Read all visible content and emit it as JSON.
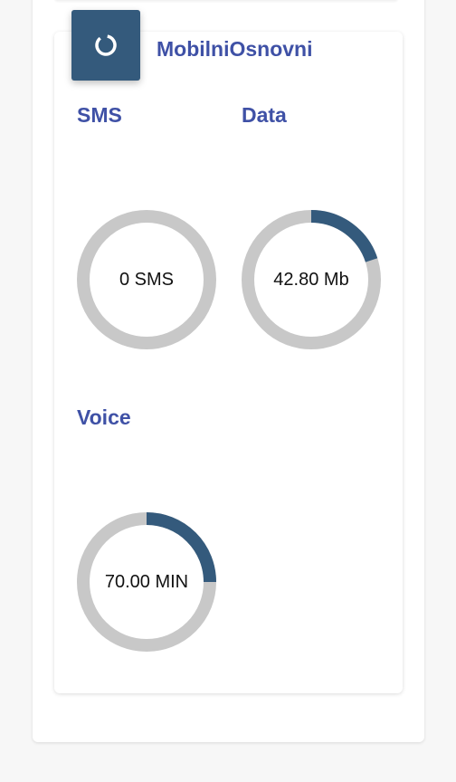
{
  "card": {
    "title": "MobilniOsnovni",
    "icon": "loading-ring-icon"
  },
  "colors": {
    "accent": "#345a7c",
    "title": "#3f51a6",
    "track": "#c8c8c8"
  },
  "meters": [
    {
      "label": "SMS",
      "value_text": "0 SMS",
      "fraction": 0.0
    },
    {
      "label": "Data",
      "value_text": "42.80 Mb",
      "fraction": 0.2
    },
    {
      "label": "Voice",
      "value_text": "70.00 MIN",
      "fraction": 0.25
    }
  ]
}
